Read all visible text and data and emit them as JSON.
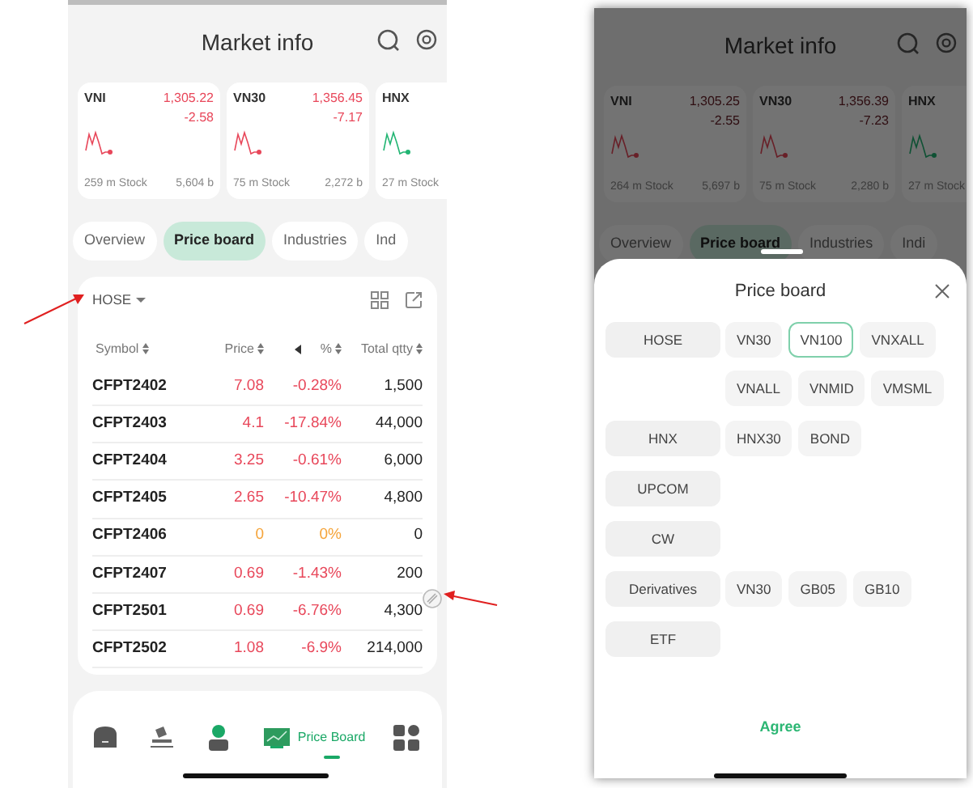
{
  "screens": [
    {
      "title": "Market info",
      "indices": [
        {
          "name": "VNI",
          "value": "1,305.22",
          "change": "-2.58",
          "volume": "259",
          "volume_unit": "m Stock",
          "turnover": "5,604",
          "turnover_unit": "b",
          "color": "#e8475a"
        },
        {
          "name": "VN30",
          "value": "1,356.45",
          "change": "-7.17",
          "volume": "75",
          "volume_unit": "m Stock",
          "turnover": "2,272",
          "turnover_unit": "b",
          "color": "#e8475a"
        },
        {
          "name": "HNX",
          "volume": "27",
          "volume_unit": "m Stock",
          "color": "#22b573"
        }
      ],
      "tabs": [
        {
          "label": "Overview",
          "selected": false
        },
        {
          "label": "Price board",
          "selected": true
        },
        {
          "label": "Industries",
          "selected": false
        },
        {
          "label": "Ind",
          "selected": false
        }
      ],
      "board": {
        "exchange": "HOSE",
        "columns": [
          "Symbol",
          "Price",
          "%",
          "Total qtty"
        ],
        "rows": [
          {
            "symbol": "CFPT2402",
            "price": "7.08",
            "change": "-0.28%",
            "qty": "1,500",
            "color": "#e8475a"
          },
          {
            "symbol": "CFPT2403",
            "price": "4.1",
            "change": "-17.84%",
            "qty": "44,000",
            "color": "#e8475a"
          },
          {
            "symbol": "CFPT2404",
            "price": "3.25",
            "change": "-0.61%",
            "qty": "6,000",
            "color": "#e8475a"
          },
          {
            "symbol": "CFPT2405",
            "price": "2.65",
            "change": "-10.47%",
            "qty": "4,800",
            "color": "#e8475a"
          },
          {
            "symbol": "CFPT2406",
            "price": "0",
            "change": "0%",
            "qty": "0",
            "color": "#f5a43a"
          },
          {
            "symbol": "CFPT2407",
            "price": "0.69",
            "change": "-1.43%",
            "qty": "200",
            "color": "#e8475a"
          },
          {
            "symbol": "CFPT2501",
            "price": "0.69",
            "change": "-6.76%",
            "qty": "4,300",
            "color": "#e8475a"
          },
          {
            "symbol": "CFPT2502",
            "price": "1.08",
            "change": "-6.9%",
            "qty": "214,000",
            "color": "#e8475a"
          }
        ]
      },
      "nav": [
        {
          "kind": "home",
          "selected": false
        },
        {
          "kind": "trade",
          "selected": false
        },
        {
          "kind": "account",
          "selected": false
        },
        {
          "kind": "board",
          "label": "Price Board",
          "selected": true
        },
        {
          "kind": "menu",
          "selected": false
        }
      ]
    },
    {
      "title": "Market info",
      "indices": [
        {
          "name": "VNI",
          "value": "1,305.25",
          "change": "-2.55",
          "volume": "264",
          "volume_unit": "m Stock",
          "turnover": "5,697",
          "turnover_unit": "b",
          "color": "#682028"
        },
        {
          "name": "VN30",
          "value": "1,356.39",
          "change": "-7.23",
          "volume": "75",
          "volume_unit": "m Stock",
          "turnover": "2,280",
          "turnover_unit": "b",
          "color": "#682028"
        },
        {
          "name": "HNX",
          "volume": "27",
          "volume_unit": "m Stock",
          "color": "#0f5134"
        }
      ],
      "tabs": [
        {
          "label": "Overview",
          "selected": false
        },
        {
          "label": "Price board",
          "selected": true
        },
        {
          "label": "Industries",
          "selected": false
        },
        {
          "label": "Indi",
          "selected": false
        }
      ],
      "sheet": {
        "title": "Price board",
        "groups": [
          {
            "label": "HOSE",
            "options": [
              {
                "label": "VN30",
                "selected": false
              },
              {
                "label": "VN100",
                "selected": true
              },
              {
                "label": "VNXALL",
                "selected": false
              },
              {
                "label": "VNALL",
                "selected": false
              },
              {
                "label": "VNMID",
                "selected": false
              },
              {
                "label": "VMSML",
                "selected": false
              }
            ]
          },
          {
            "label": "HNX",
            "options": [
              {
                "label": "HNX30",
                "selected": false
              },
              {
                "label": "BOND",
                "selected": false
              }
            ]
          },
          {
            "label": "UPCOM"
          },
          {
            "label": "CW"
          },
          {
            "label": "Derivatives",
            "options": [
              {
                "label": "VN30",
                "selected": false
              },
              {
                "label": "GB05",
                "selected": false
              },
              {
                "label": "GB10",
                "selected": false
              }
            ]
          },
          {
            "label": "ETF"
          }
        ],
        "confirm": "Agree"
      }
    }
  ]
}
